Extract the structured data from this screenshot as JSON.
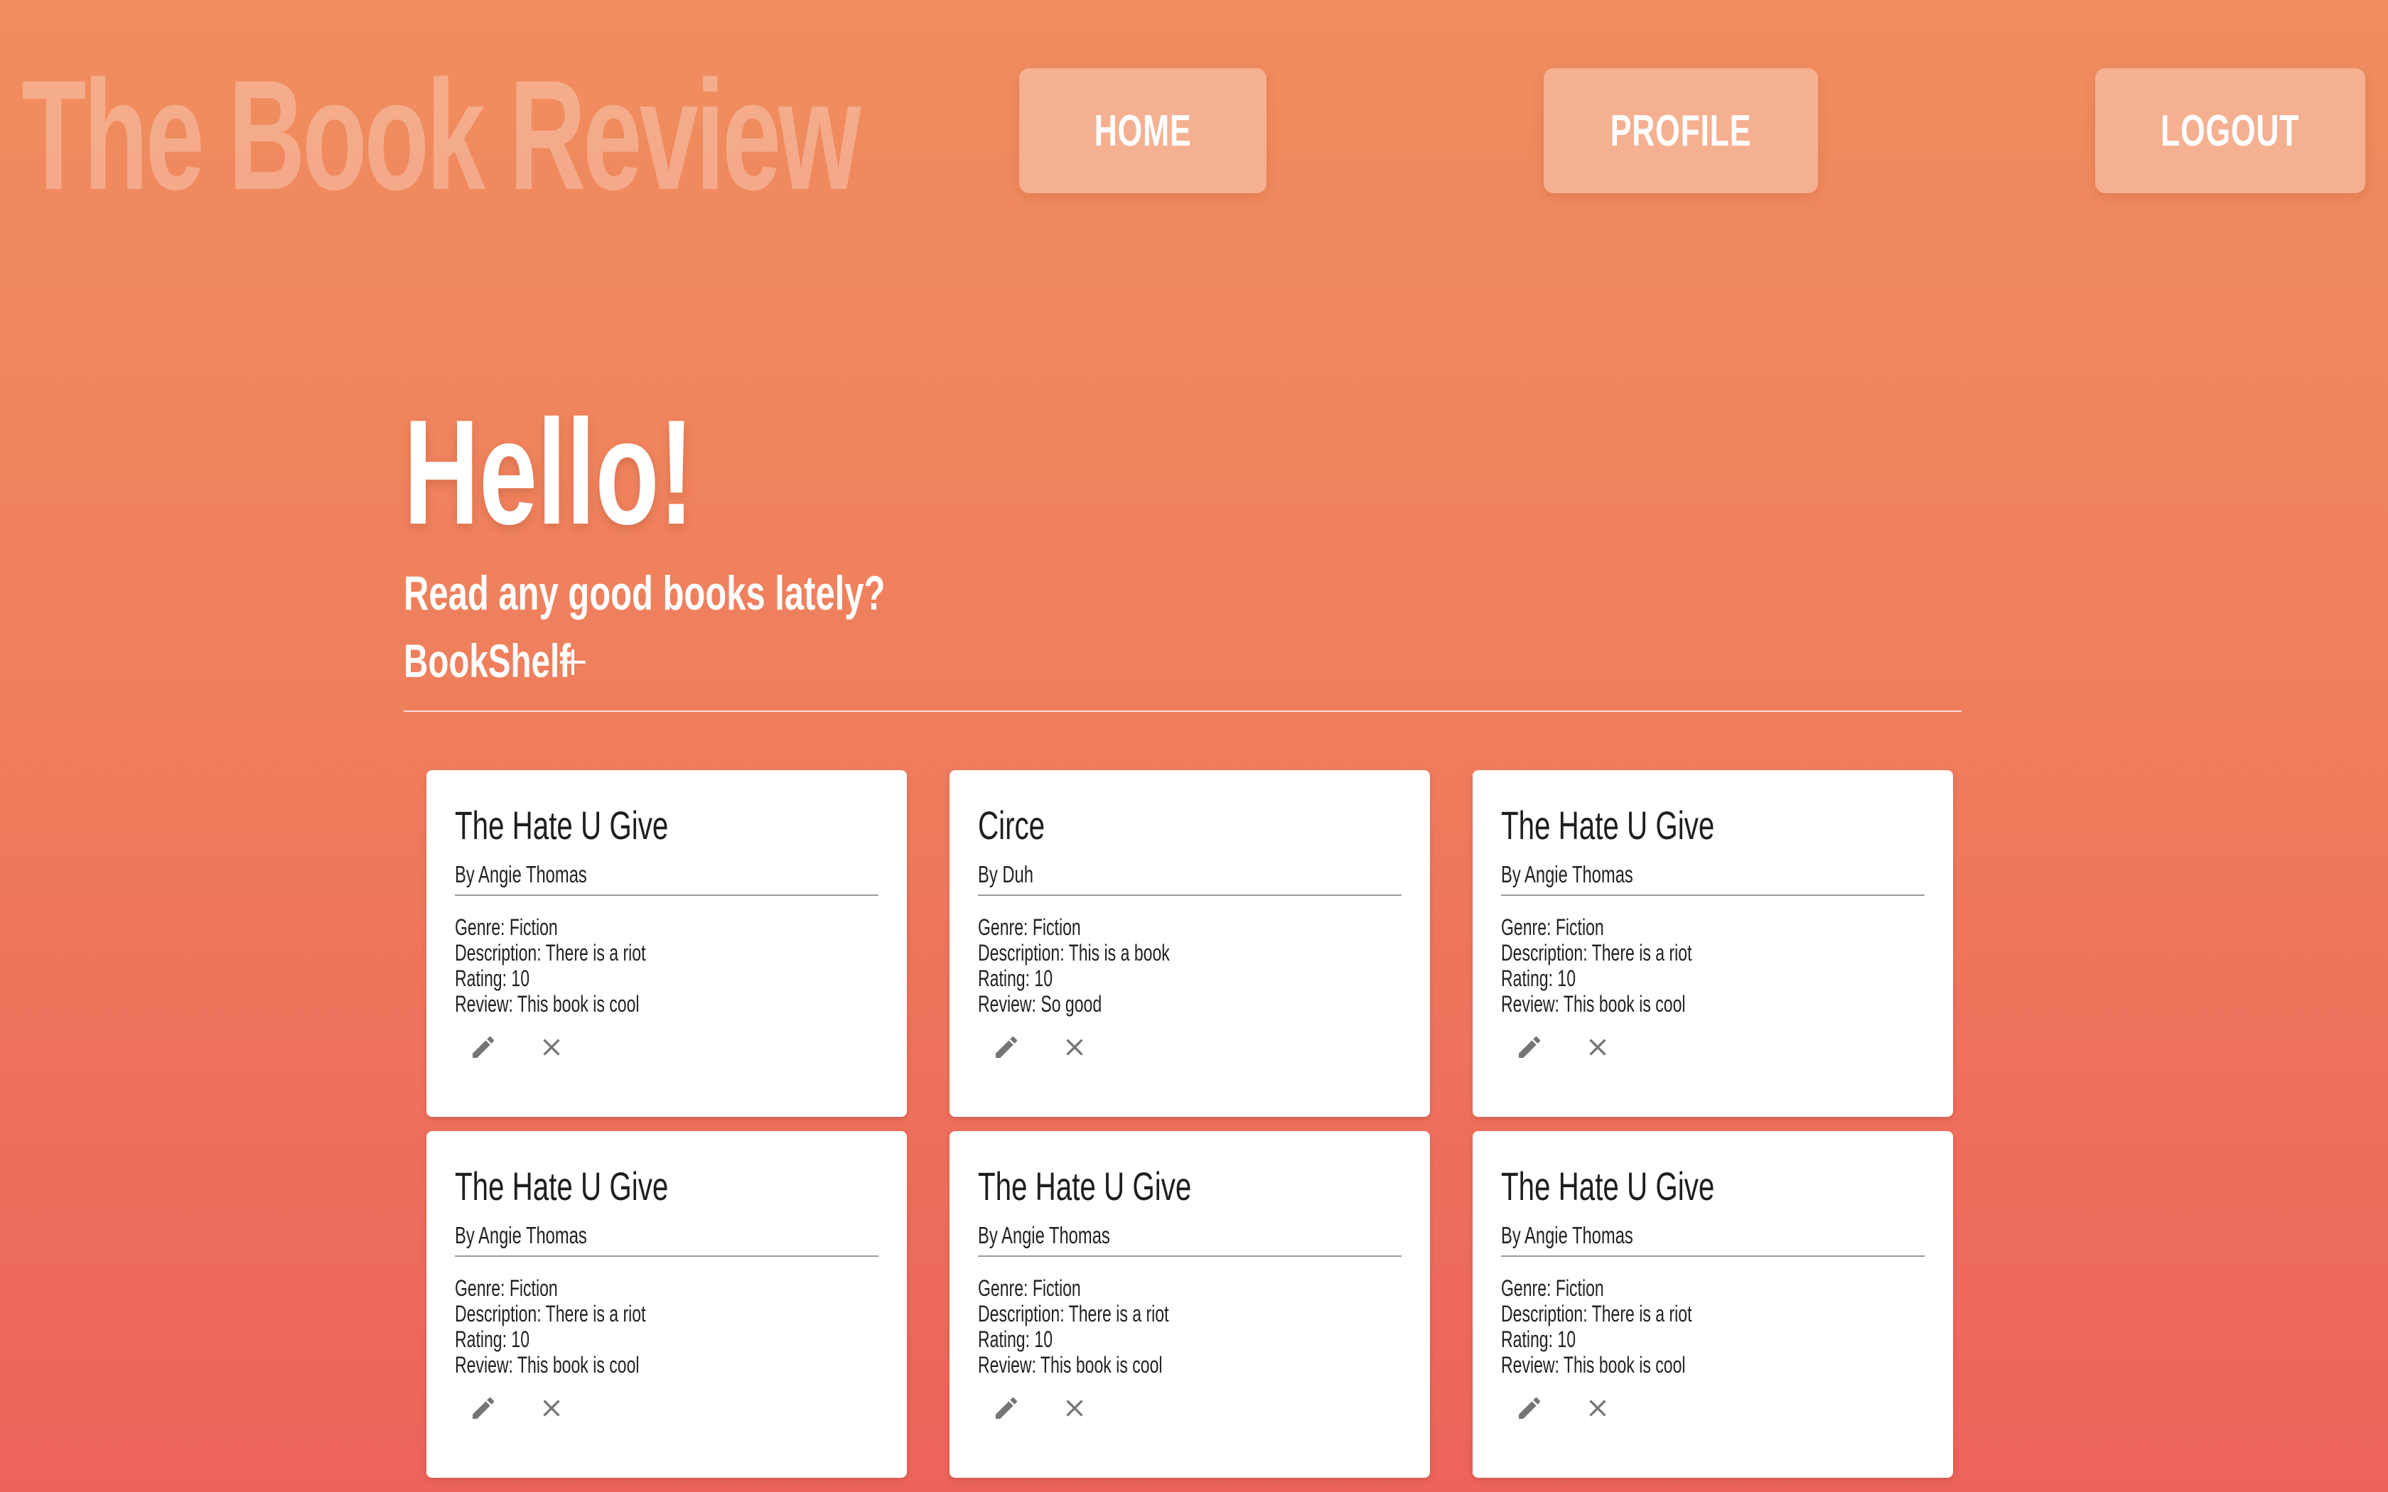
{
  "header": {
    "site_title": "The Book Review",
    "nav": {
      "home": "HOME",
      "profile": "PROFILE",
      "logout": "LOGOUT"
    }
  },
  "hero": {
    "greeting": "Hello!",
    "subtitle": "Read any good books lately?",
    "shelf_title": "BookShelf",
    "add_icon": "plus-icon"
  },
  "books": [
    {
      "title": "The Hate U Give",
      "author": "By Angie Thomas",
      "genre": "Genre: Fiction",
      "description": "Description: There is a riot",
      "rating": "Rating: 10",
      "review": "Review: This book is cool"
    },
    {
      "title": "Circe",
      "author": "By Duh",
      "genre": "Genre: Fiction",
      "description": "Description: This is a book",
      "rating": "Rating: 10",
      "review": "Review: So good"
    },
    {
      "title": "The Hate U Give",
      "author": "By Angie Thomas",
      "genre": "Genre: Fiction",
      "description": "Description: There is a riot",
      "rating": "Rating: 10",
      "review": "Review: This book is cool"
    },
    {
      "title": "The Hate U Give",
      "author": "By Angie Thomas",
      "genre": "Genre: Fiction",
      "description": "Description: There is a riot",
      "rating": "Rating: 10",
      "review": "Review: This book is cool"
    },
    {
      "title": "The Hate U Give",
      "author": "By Angie Thomas",
      "genre": "Genre: Fiction",
      "description": "Description: There is a riot",
      "rating": "Rating: 10",
      "review": "Review: This book is cool"
    },
    {
      "title": "The Hate U Give",
      "author": "By Angie Thomas",
      "genre": "Genre: Fiction",
      "description": "Description: There is a riot",
      "rating": "Rating: 10",
      "review": "Review: This book is cool"
    }
  ],
  "card_actions": {
    "edit_icon": "pencil-icon",
    "delete_icon": "close-icon"
  },
  "colors": {
    "gradient_top": "#f08e5e",
    "gradient_bottom": "#ec635a",
    "card_bg": "#ffffff",
    "icon_gray": "#757575"
  }
}
